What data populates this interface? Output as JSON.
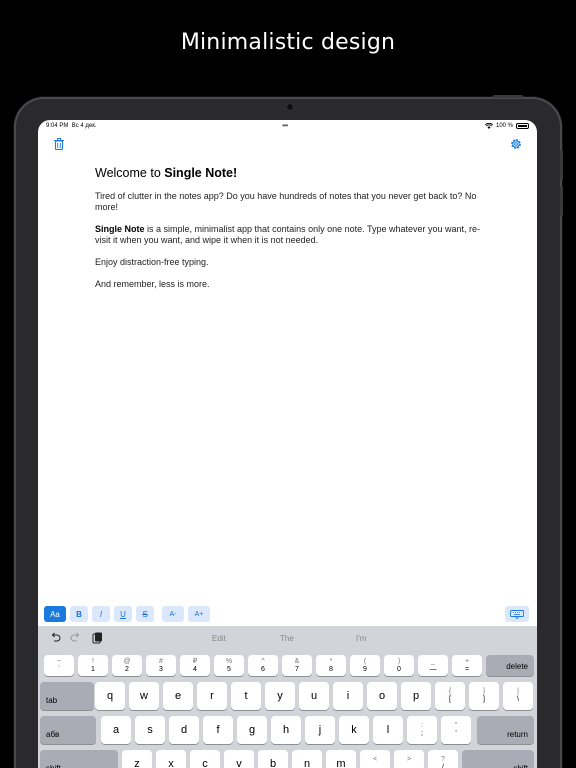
{
  "headline": "Minimalistic design",
  "status": {
    "time": "9:04 PM",
    "date": "Вс 4 дек.",
    "battery": "100 %"
  },
  "note": {
    "title_prefix": "Welcome to ",
    "title_bold": "Single Note!",
    "p1": "Tired of clutter in the notes app? Do you have hundreds of notes that you never get back to? No more!",
    "p2_bold": "Single Note",
    "p2_rest": " is a simple, minimalist app that contains only one note. Type whatever you want, re-visit it when you want, and wipe it when it is not needed.",
    "p3": "Enjoy distraction-free typing.",
    "p4": "And remember, less is more."
  },
  "format_bar": {
    "aa": "Aa",
    "bold": "B",
    "italic": "I",
    "underline": "U",
    "strike": "S",
    "size_down": "A-",
    "size_up": "A+"
  },
  "keyboard": {
    "suggestions": [
      "Edit",
      "The",
      "I'm"
    ],
    "number_row": [
      {
        "top": "~",
        "bottom": "`"
      },
      {
        "top": "!",
        "bottom": "1"
      },
      {
        "top": "@",
        "bottom": "2"
      },
      {
        "top": "#",
        "bottom": "3"
      },
      {
        "top": "₽",
        "bottom": "4"
      },
      {
        "top": "%",
        "bottom": "5"
      },
      {
        "top": "^",
        "bottom": "6"
      },
      {
        "top": "&",
        "bottom": "7"
      },
      {
        "top": "*",
        "bottom": "8"
      },
      {
        "top": "(",
        "bottom": "9"
      },
      {
        "top": ")",
        "bottom": "0"
      },
      {
        "top": "_",
        "bottom": "—"
      },
      {
        "top": "+",
        "bottom": "="
      }
    ],
    "delete": "delete",
    "tab": "tab",
    "row1": [
      "q",
      "w",
      "e",
      "r",
      "t",
      "y",
      "u",
      "i",
      "o",
      "p"
    ],
    "row1_extra": [
      {
        "top": "{",
        "bottom": "["
      },
      {
        "top": "}",
        "bottom": "]"
      },
      {
        "top": "|",
        "bottom": "\\"
      }
    ],
    "lang": "абв",
    "row2": [
      "a",
      "s",
      "d",
      "f",
      "g",
      "h",
      "j",
      "k",
      "l"
    ],
    "row2_extra": [
      {
        "top": ":",
        "bottom": ";"
      },
      {
        "top": "\"",
        "bottom": "'"
      }
    ],
    "return": "return",
    "shift": "shift",
    "row3": [
      "z",
      "x",
      "c",
      "v",
      "b",
      "n",
      "m"
    ],
    "row3_extra": [
      {
        "top": "<",
        "bottom": ","
      },
      {
        "top": ">",
        "bottom": "."
      },
      {
        "top": "?",
        "bottom": "/"
      }
    ]
  },
  "colors": {
    "accent": "#1a7ae0",
    "accent_light": "#dbe8fb"
  }
}
